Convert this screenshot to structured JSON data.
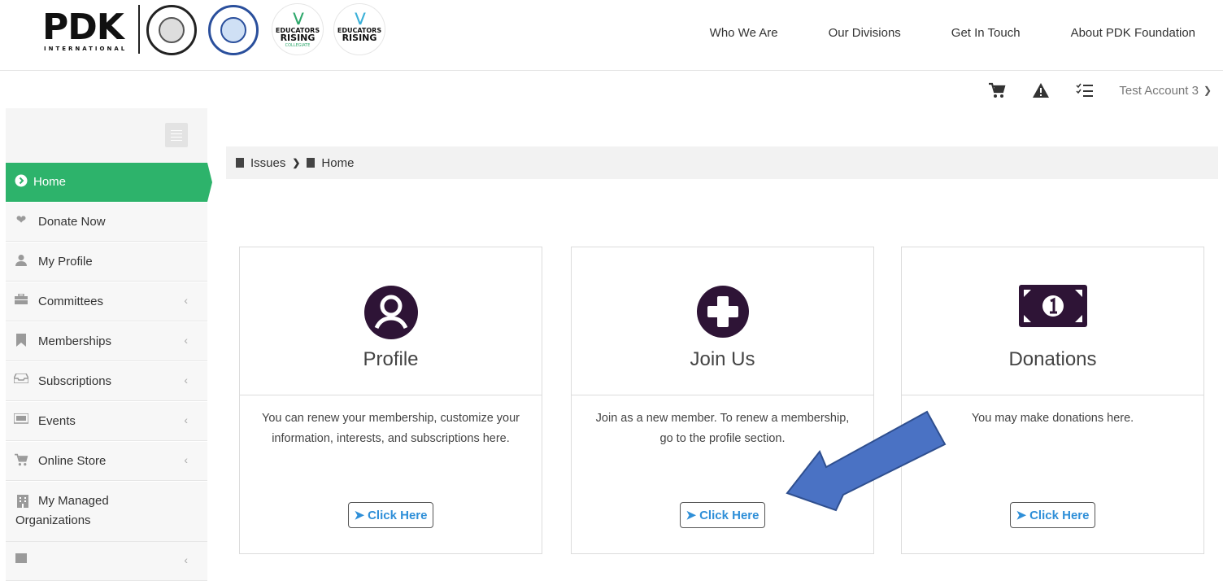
{
  "brand": {
    "logo_text": "PDK",
    "logo_subtext": "INTERNATIONAL",
    "badge1_line1": "EDUCATORS",
    "badge1_line2": "RISING",
    "badge1_sub": "COLLEGIATE",
    "badge2_line1": "EDUCATORS",
    "badge2_line2": "RISING"
  },
  "topnav": {
    "items": [
      {
        "label": "Who We Are"
      },
      {
        "label": "Our Divisions"
      },
      {
        "label": "Get In Touch"
      },
      {
        "label": "About PDK Foundation"
      }
    ]
  },
  "utility": {
    "icons": [
      "cart-icon",
      "warning-icon",
      "checklist-icon"
    ],
    "account_name": "Test Account 3"
  },
  "sidebar": {
    "items": [
      {
        "label": "Home",
        "icon": "circle-chevron-right-icon",
        "active": true
      },
      {
        "label": "Donate Now",
        "icon": "heart-icon"
      },
      {
        "label": "My Profile",
        "icon": "user-icon"
      },
      {
        "label": "Committees",
        "icon": "briefcase-icon",
        "expandable": true
      },
      {
        "label": "Memberships",
        "icon": "bookmark-icon",
        "expandable": true
      },
      {
        "label": "Subscriptions",
        "icon": "inbox-icon",
        "expandable": true
      },
      {
        "label": "Events",
        "icon": "monitor-icon",
        "expandable": true
      },
      {
        "label": "Online Store",
        "icon": "cart-icon",
        "expandable": true
      },
      {
        "label": "My Managed Organizations",
        "icon": "building-icon"
      }
    ]
  },
  "breadcrumb": {
    "items": [
      "Issues",
      "Home"
    ]
  },
  "cards": [
    {
      "title": "Profile",
      "icon": "user-circle-icon",
      "description": "You can renew your membership, customize your information, interests, and subscriptions here.",
      "button_label": "Click Here"
    },
    {
      "title": "Join Us",
      "icon": "plus-circle-icon",
      "description": "Join as a new member. To renew a membership, go to the profile section.",
      "button_label": "Click Here"
    },
    {
      "title": "Donations",
      "icon": "money-bill-icon",
      "description": "You may make donations here.",
      "button_label": "Click Here"
    }
  ],
  "colors": {
    "accent_green": "#2db36b",
    "link_blue": "#2f8fd8",
    "icon_purple": "#2e1436",
    "annotation_arrow": "#4a72c4"
  }
}
